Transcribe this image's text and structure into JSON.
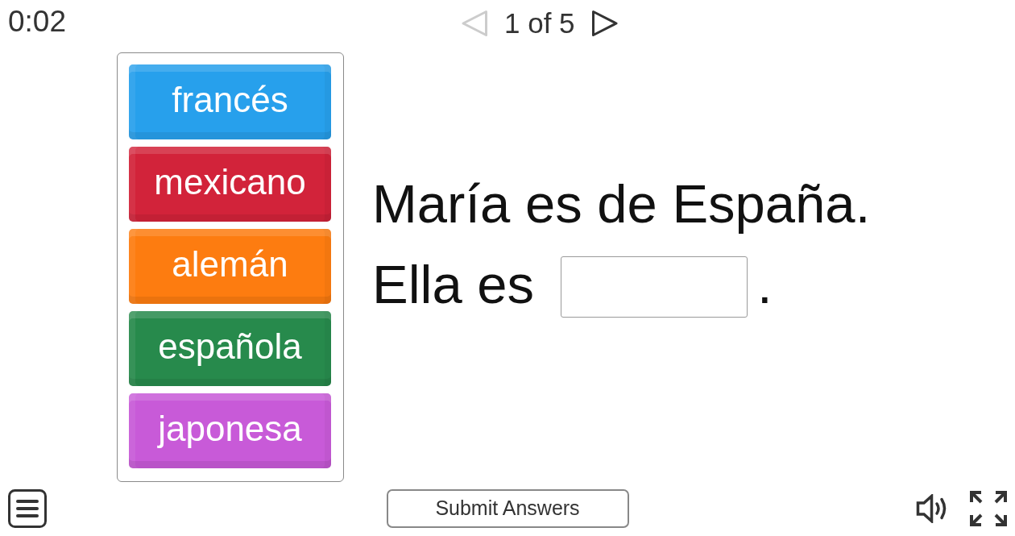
{
  "timer": "0:02",
  "pager": {
    "previous": {
      "disabled": true
    },
    "label": "1 of 5",
    "next": {
      "disabled": false
    }
  },
  "word_bank": [
    {
      "label": "francés",
      "color": "#27a0ec"
    },
    {
      "label": "mexicano",
      "color": "#d2233a"
    },
    {
      "label": "alemán",
      "color": "#fd7c10"
    },
    {
      "label": "española",
      "color": "#278a4c"
    },
    {
      "label": "japonesa",
      "color": "#c85ad8"
    }
  ],
  "question": {
    "sentence": "María es de España.",
    "parts": [
      {
        "kind": "text",
        "text": "Ella es"
      },
      {
        "kind": "blank"
      },
      {
        "kind": "text",
        "text": "."
      }
    ]
  },
  "submit_button": "Submit Answers"
}
